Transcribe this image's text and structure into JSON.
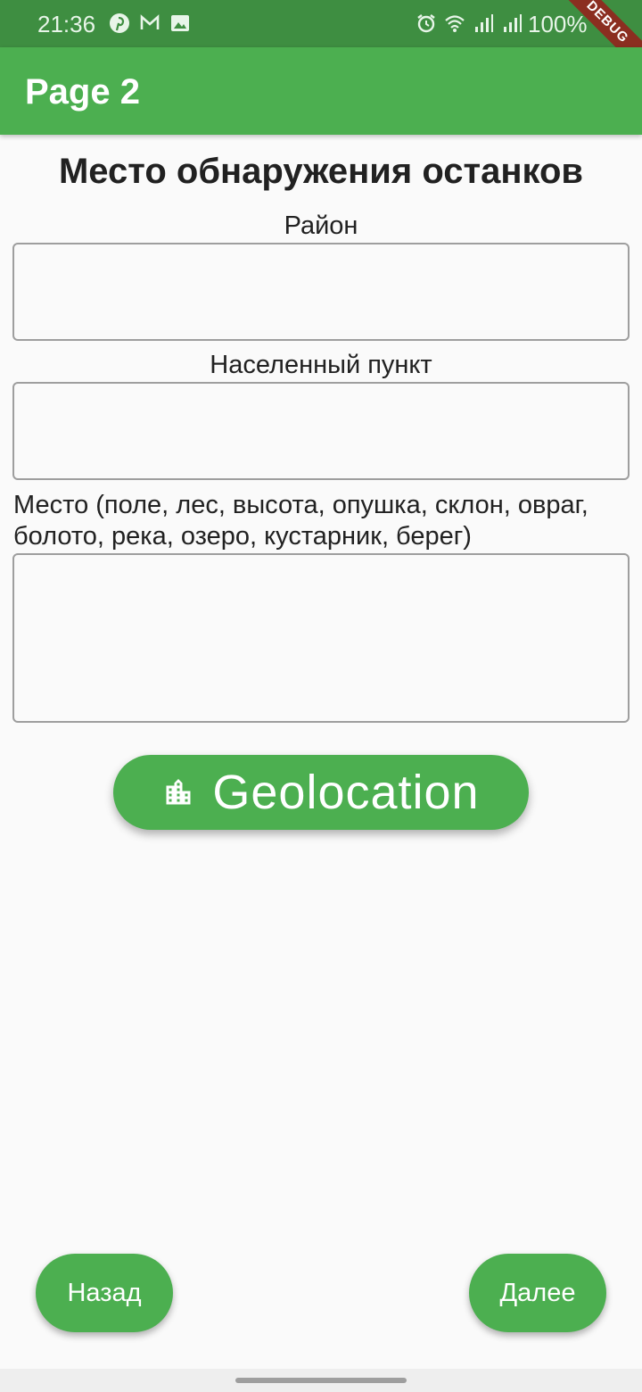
{
  "status_bar": {
    "time": "21:36",
    "left_icons": [
      "pinterest-icon",
      "gmail-icon",
      "gallery-icon"
    ],
    "right_icons": [
      "alarm-icon",
      "wifi-icon",
      "signal-icon",
      "signal-icon"
    ],
    "battery": "100%"
  },
  "debug_banner": "DEBUG",
  "app_bar": {
    "title": "Page 2"
  },
  "page": {
    "title": "Место обнаружения останков",
    "fields": {
      "district": {
        "label": "Район",
        "value": ""
      },
      "settlement": {
        "label": "Населенный пункт",
        "value": ""
      },
      "place": {
        "label": "Место (поле, лес, высота, опушка, склон, овраг, болото, река, озеро, кустарник, берег)",
        "value": ""
      }
    },
    "geo_button": {
      "label": "Geolocation",
      "icon": "location-city-icon"
    }
  },
  "nav": {
    "back_label": "Назад",
    "next_label": "Далее"
  },
  "colors": {
    "primary": "#4caf50",
    "status_bar": "#3e8e41",
    "background": "#fafafa"
  }
}
